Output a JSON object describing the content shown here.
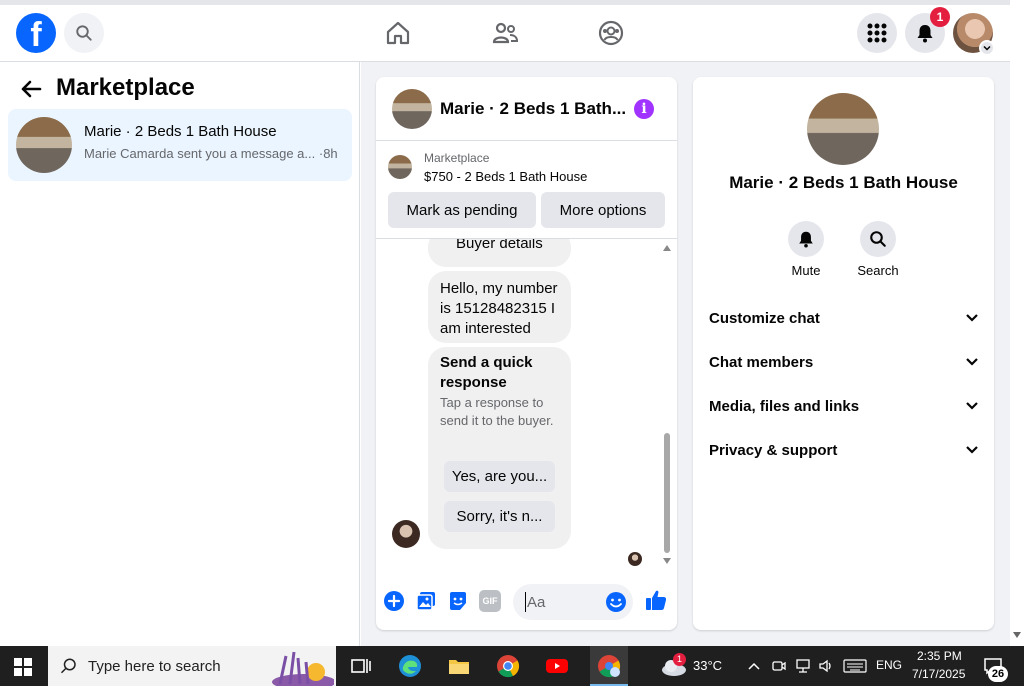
{
  "app": {
    "logo_letter": "f",
    "notifications_badge": "1"
  },
  "left": {
    "title": "Marketplace",
    "conversation": {
      "title": "Marie · 2 Beds 1 Bath House",
      "preview": "Marie Camarda sent you a message a...",
      "time": "·8h"
    }
  },
  "chat": {
    "title": "Marie · 2 Beds 1 Bath...",
    "listing": {
      "category": "Marketplace",
      "price_title": "$750 - 2 Beds 1 Bath House",
      "mark_pending": "Mark as pending",
      "more_options": "More options"
    },
    "messages": {
      "cut_bubble": "Buyer details",
      "text_message": "Hello, my number is 15128482315 I am interested",
      "quick_title": "Send a quick response",
      "quick_sub": "Tap a response to send it to the buyer.",
      "quick_options": [
        "Yes, are you...",
        "Sorry, it's n..."
      ]
    },
    "composer": {
      "placeholder": "Aa",
      "gif_label": "GIF"
    }
  },
  "panel": {
    "title": "Marie · 2 Beds 1 Bath House",
    "actions": [
      "Mute",
      "Search"
    ],
    "rows": [
      "Customize chat",
      "Chat members",
      "Media, files and links",
      "Privacy & support"
    ]
  },
  "taskbar": {
    "search_placeholder": "Type here to search",
    "weather_badge": "1",
    "temperature": "33°C",
    "language": "ENG",
    "time": "2:35 PM",
    "date": "7/17/2025",
    "notif_count": "26"
  },
  "colors": {
    "fb_blue": "#0866ff",
    "badge_red": "#e41e3f",
    "info_purple": "#a033ff",
    "bubble_grey": "#f0f0f0"
  }
}
